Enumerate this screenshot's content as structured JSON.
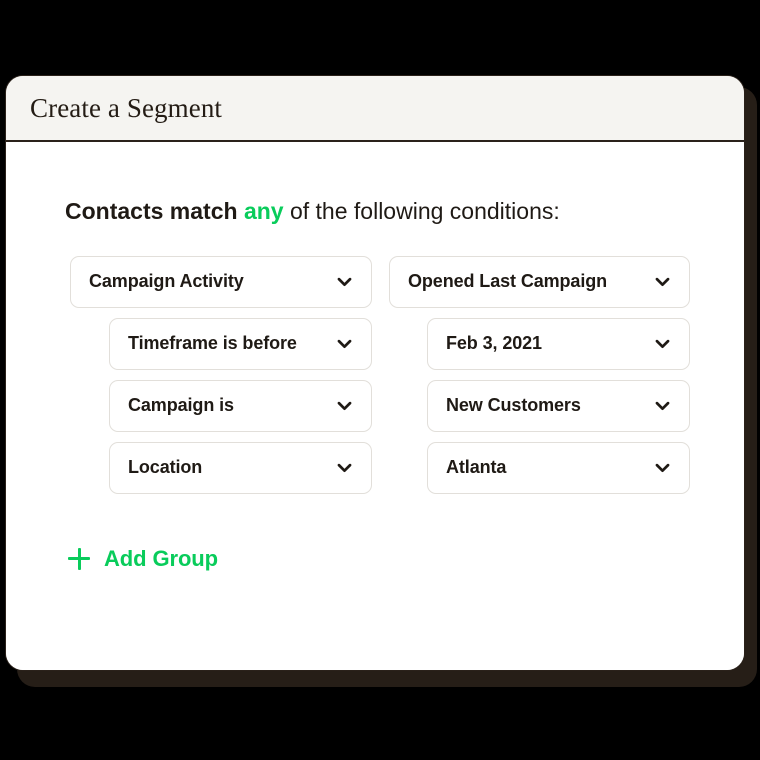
{
  "page": {
    "background_color": "#000000"
  },
  "card": {
    "background_color": "#FFFFFF",
    "border_color": "#2A211A",
    "shadow_color": "#261E17",
    "header": {
      "title": "Create a Segment",
      "background_color": "#F5F4F1"
    }
  },
  "heading": {
    "prefix": "Contacts match ",
    "accent": "any",
    "suffix": " of the following conditions:",
    "accent_color": "#09CC5B"
  },
  "conditions": [
    {
      "level": "top",
      "field": {
        "value": "Campaign Activity",
        "icon": "chevron-down-icon"
      },
      "operand": {
        "value": "Opened Last Campaign",
        "icon": "chevron-down-icon"
      }
    },
    {
      "level": "sub",
      "field": {
        "value": "Timeframe is before",
        "icon": "chevron-down-icon"
      },
      "operand": {
        "value": "Feb 3, 2021",
        "icon": "chevron-down-icon"
      }
    },
    {
      "level": "sub",
      "field": {
        "value": "Campaign is",
        "icon": "chevron-down-icon"
      },
      "operand": {
        "value": "New Customers",
        "icon": "chevron-down-icon"
      }
    },
    {
      "level": "sub",
      "field": {
        "value": "Location",
        "icon": "chevron-down-icon"
      },
      "operand": {
        "value": "Atlanta",
        "icon": "chevron-down-icon"
      }
    }
  ],
  "add_group": {
    "label": "Add Group",
    "icon": "plus-icon",
    "color": "#09CC5B"
  }
}
